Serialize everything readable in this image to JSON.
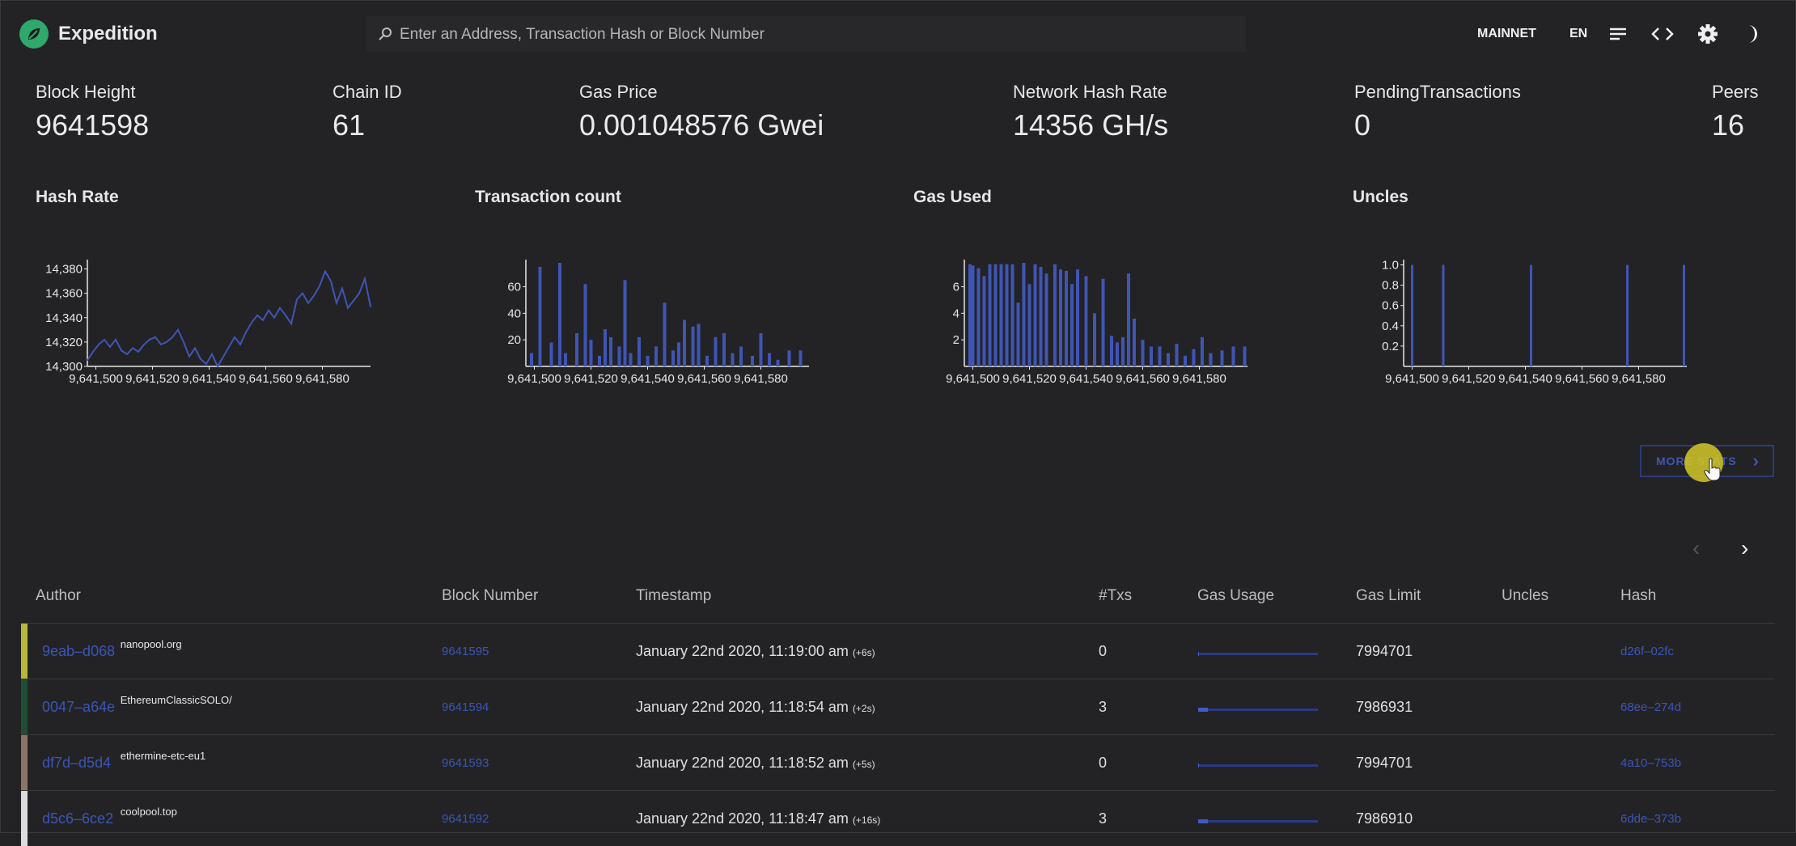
{
  "app": {
    "title": "Expedition"
  },
  "search": {
    "placeholder": "Enter an Address, Transaction Hash or Block Number"
  },
  "topbar": {
    "network": "MAINNET",
    "language": "EN"
  },
  "stats": [
    {
      "label": "Block Height",
      "value": "9641598"
    },
    {
      "label": "Chain ID",
      "value": "61"
    },
    {
      "label": "Gas Price",
      "value": "0.001048576 Gwei"
    },
    {
      "label": "Network Hash Rate",
      "value": "14356 GH/s"
    },
    {
      "label": "PendingTransactions",
      "value": "0"
    },
    {
      "label": "Peers",
      "value": "16"
    }
  ],
  "charts_section": {
    "titles": [
      "Hash Rate",
      "Transaction count",
      "Gas Used",
      "Uncles"
    ],
    "more_button": "MORE STATS"
  },
  "chart_data": [
    {
      "type": "line",
      "title": "Hash Rate",
      "x_ticks": [
        "9,641,500",
        "9,641,520",
        "9,641,540",
        "9,641,560",
        "9,641,580"
      ],
      "y_ticks": [
        "14,300",
        "14,320",
        "14,340",
        "14,360",
        "14,380"
      ],
      "ylim": [
        14300,
        14385
      ],
      "xlim": [
        9641497,
        9641597
      ],
      "x": [
        9641497,
        9641499,
        9641501,
        9641503,
        9641505,
        9641507,
        9641509,
        9641511,
        9641513,
        9641515,
        9641517,
        9641519,
        9641521,
        9641523,
        9641525,
        9641527,
        9641529,
        9641531,
        9641533,
        9641535,
        9641537,
        9641539,
        9641541,
        9641543,
        9641545,
        9641547,
        9641549,
        9641551,
        9641553,
        9641555,
        9641557,
        9641559,
        9641561,
        9641563,
        9641565,
        9641567,
        9641569,
        9641571,
        9641573,
        9641575,
        9641577,
        9641579,
        9641581,
        9641583,
        9641585,
        9641587,
        9641589,
        9641591,
        9641593,
        9641595,
        9641597
      ],
      "values": [
        14305,
        14312,
        14318,
        14322,
        14316,
        14322,
        14313,
        14310,
        14315,
        14312,
        14318,
        14322,
        14324,
        14318,
        14320,
        14324,
        14330,
        14320,
        14308,
        14315,
        14306,
        14302,
        14310,
        14300,
        14308,
        14316,
        14324,
        14318,
        14328,
        14336,
        14342,
        14338,
        14346,
        14340,
        14348,
        14342,
        14335,
        14355,
        14360,
        14352,
        14358,
        14366,
        14378,
        14370,
        14352,
        14364,
        14348,
        14354,
        14360,
        14372,
        14349
      ]
    },
    {
      "type": "bar",
      "title": "Transaction count",
      "x_ticks": [
        "9,641,500",
        "9,641,520",
        "9,641,540",
        "9,641,560",
        "9,641,580"
      ],
      "y_ticks": [
        "20",
        "40",
        "60"
      ],
      "ylim": [
        0,
        78
      ],
      "xlim": [
        9641497,
        9641597
      ],
      "x": [
        9641499,
        9641502,
        9641506,
        9641509,
        9641511,
        9641515,
        9641518,
        9641520,
        9641523,
        9641525,
        9641527,
        9641530,
        9641532,
        9641534,
        9641537,
        9641540,
        9641543,
        9641546,
        9641549,
        9641551,
        9641553,
        9641556,
        9641558,
        9641561,
        9641564,
        9641567,
        9641570,
        9641573,
        9641577,
        9641580,
        9641583,
        9641586,
        9641590,
        9641594
      ],
      "values": [
        10,
        75,
        18,
        78,
        10,
        25,
        62,
        20,
        8,
        28,
        22,
        15,
        65,
        10,
        22,
        8,
        15,
        48,
        12,
        18,
        35,
        30,
        32,
        8,
        22,
        25,
        10,
        15,
        8,
        25,
        10,
        5,
        12,
        12
      ]
    },
    {
      "type": "bar",
      "title": "Gas Used",
      "x_ticks": [
        "9,641,500",
        "9,641,520",
        "9,641,540",
        "9,641,560",
        "9,641,580"
      ],
      "y_ticks": [
        "2",
        "4",
        "6"
      ],
      "ylim": [
        0,
        7.8
      ],
      "xlim": [
        9641497,
        9641597
      ],
      "x": [
        9641499,
        9641500,
        9641502,
        9641504,
        9641506,
        9641508,
        9641510,
        9641512,
        9641514,
        9641516,
        9641518,
        9641520,
        9641522,
        9641524,
        9641526,
        9641529,
        9641531,
        9641533,
        9641535,
        9641537,
        9641540,
        9641543,
        9641546,
        9641549,
        9641551,
        9641553,
        9641555,
        9641557,
        9641560,
        9641563,
        9641566,
        9641569,
        9641572,
        9641575,
        9641578,
        9641581,
        9641584,
        9641588,
        9641592,
        9641596
      ],
      "values": [
        7.7,
        7.6,
        7.4,
        6.8,
        7.7,
        7.7,
        7.7,
        7.7,
        7.7,
        4.8,
        7.8,
        6.2,
        7.7,
        7.5,
        7.0,
        7.7,
        7.3,
        7.2,
        6.2,
        7.3,
        6.8,
        4.0,
        6.6,
        2.3,
        1.8,
        2.2,
        7.0,
        3.6,
        2.0,
        1.5,
        1.5,
        1.0,
        1.7,
        0.8,
        1.3,
        2.2,
        1.0,
        1.2,
        1.5,
        1.5
      ]
    },
    {
      "type": "bar",
      "title": "Uncles",
      "x_ticks": [
        "9,641,500",
        "9,641,520",
        "9,641,540",
        "9,641,560",
        "9,641,580"
      ],
      "y_ticks": [
        "0.2",
        "0.4",
        "0.6",
        "0.8",
        "1.0"
      ],
      "ylim": [
        0,
        1.02
      ],
      "xlim": [
        9641497,
        9641597
      ],
      "x": [
        9641500,
        9641511,
        9641542,
        9641576,
        9641596
      ],
      "values": [
        1,
        1,
        1,
        1,
        1
      ]
    }
  ],
  "pager": {
    "prev": "‹",
    "next": "›"
  },
  "table": {
    "headers": [
      "Author",
      "Block Number",
      "Timestamp",
      "#Txs",
      "Gas Usage",
      "Gas Limit",
      "Uncles",
      "Hash"
    ],
    "rows": [
      {
        "author": "9eab–d068",
        "miner": "nanopool.org",
        "block": "9641595",
        "timestamp": "January 22nd 2020, 11:19:00 am",
        "ago": "(+6s)",
        "txs": "0",
        "gas_usage_fraction": 0.005,
        "gas_limit": "7994701",
        "uncles": "",
        "hash": "d26f–02fc",
        "color": "#b8b83a"
      },
      {
        "author": "0047–a64e",
        "miner": "EthereumClassicSOLO/",
        "block": "9641594",
        "timestamp": "January 22nd 2020, 11:18:54 am",
        "ago": "(+2s)",
        "txs": "3",
        "gas_usage_fraction": 0.08,
        "gas_limit": "7986931",
        "uncles": "",
        "hash": "68ee–274d",
        "color": "#214d36"
      },
      {
        "author": "df7d–d5d4",
        "miner": "ethermine-etc-eu1",
        "block": "9641593",
        "timestamp": "January 22nd 2020, 11:18:52 am",
        "ago": "(+5s)",
        "txs": "0",
        "gas_usage_fraction": 0.005,
        "gas_limit": "7994701",
        "uncles": "",
        "hash": "4a10–753b",
        "color": "#8c7566"
      },
      {
        "author": "d5c6–6ce2",
        "miner": "coolpool.top",
        "block": "9641592",
        "timestamp": "January 22nd 2020, 11:18:47 am",
        "ago": "(+16s)",
        "txs": "3",
        "gas_usage_fraction": 0.08,
        "gas_limit": "7986910",
        "uncles": "",
        "hash": "6dde–373b",
        "color": "#dcdcdc"
      }
    ]
  },
  "colors": {
    "background": "#232325",
    "accent": "#3f55b5",
    "logo": "#2ea86b",
    "bar": "#3f55b5"
  },
  "icons": [
    "search-icon",
    "menu-icon",
    "code-icon",
    "gear-icon",
    "moon-icon",
    "chevron-right-icon",
    "chevron-left-icon"
  ]
}
